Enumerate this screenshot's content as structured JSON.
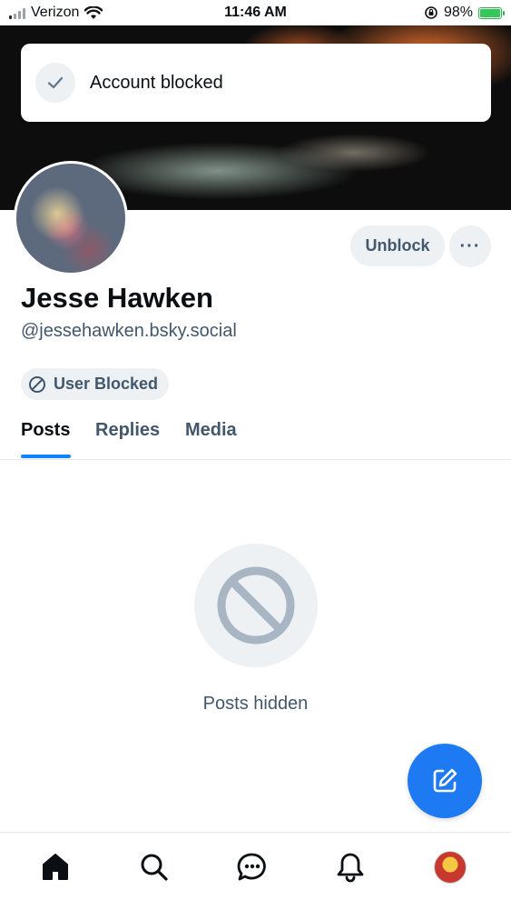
{
  "status_bar": {
    "carrier": "Verizon",
    "time": "11:46 AM",
    "battery": "98%"
  },
  "toast": {
    "message": "Account blocked",
    "icon": "check-icon"
  },
  "profile": {
    "display_name": "Jesse Hawken",
    "handle": "@jessehawken.bsky.social",
    "unblock_label": "Unblock",
    "more_label": "···",
    "blocked_badge": "User Blocked"
  },
  "tabs": [
    {
      "label": "Posts",
      "active": true
    },
    {
      "label": "Replies",
      "active": false
    },
    {
      "label": "Media",
      "active": false
    }
  ],
  "empty_state": {
    "text": "Posts hidden",
    "icon": "ban-icon"
  },
  "bottom_nav": {
    "items": [
      "home-icon",
      "search-icon",
      "chat-icon",
      "bell-icon",
      "profile-avatar"
    ]
  },
  "colors": {
    "accent": "#1083fe",
    "fab": "#1d7af2",
    "muted_text": "#42576c",
    "pill_bg": "#eef1f4"
  }
}
